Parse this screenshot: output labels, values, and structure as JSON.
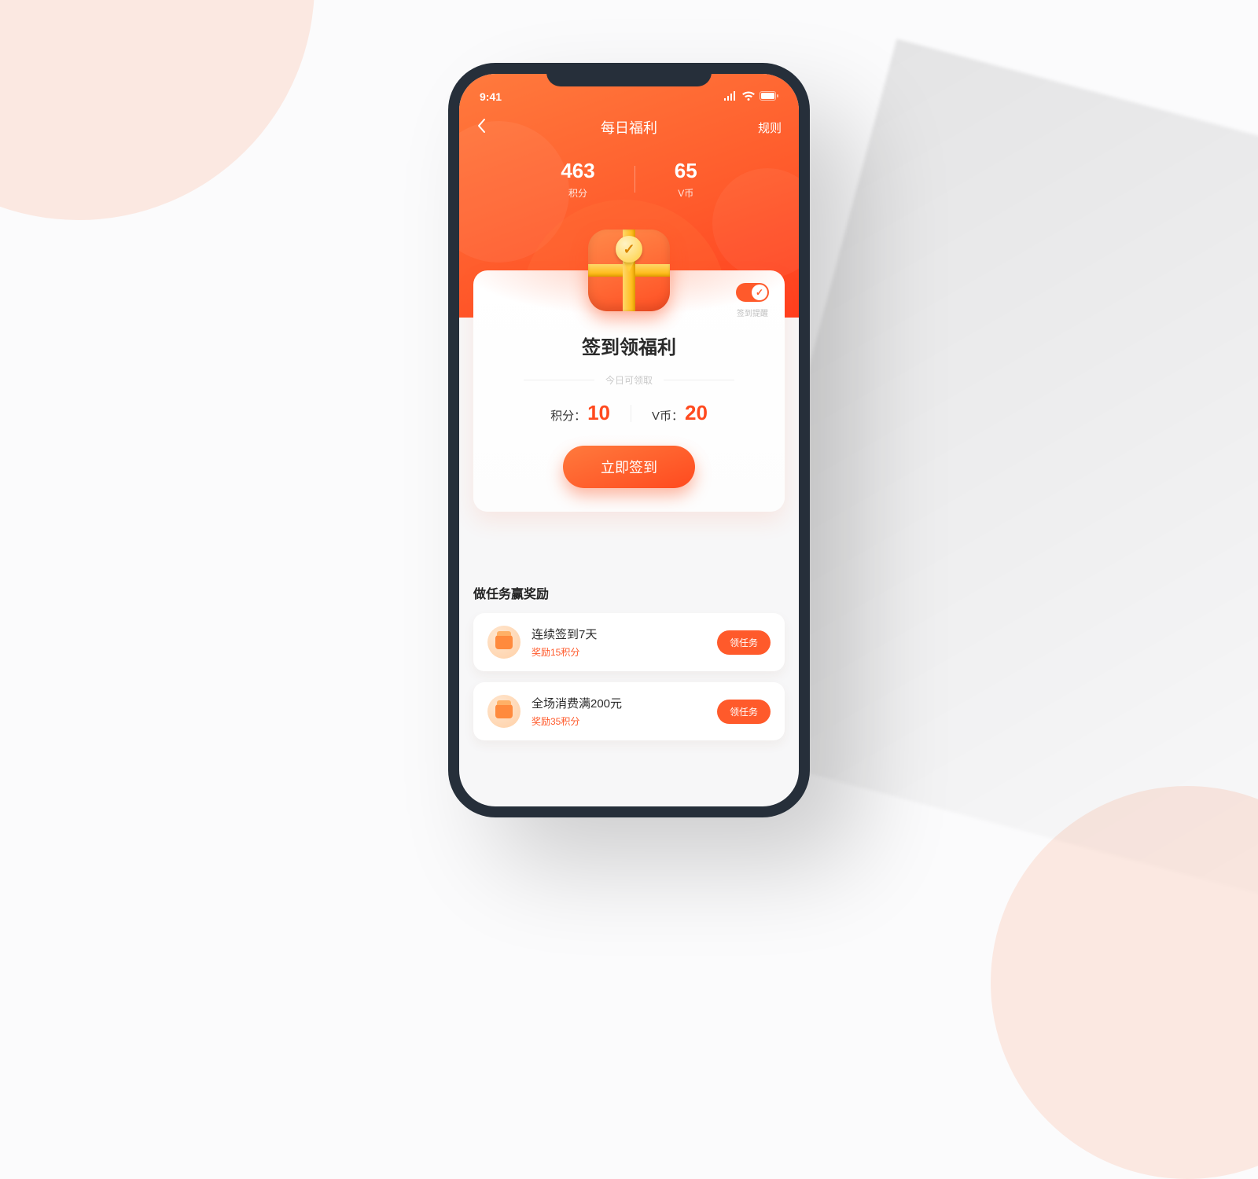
{
  "status_bar": {
    "time": "9:41"
  },
  "nav": {
    "title": "每日福利",
    "rules": "规则"
  },
  "stats": {
    "points_value": "463",
    "points_label": "积分",
    "vcoin_value": "65",
    "vcoin_label": "V币"
  },
  "signin": {
    "reminder_label": "签到提醒",
    "title": "签到领福利",
    "today_label": "今日可领取",
    "points_label": "积分：",
    "points_value": "10",
    "vcoin_label": "V币：",
    "vcoin_value": "20",
    "button": "立即签到"
  },
  "tasks": {
    "section_title": "做任务赢奖励",
    "items": [
      {
        "name": "连续签到7天",
        "reward": "奖励15积分",
        "button": "领任务"
      },
      {
        "name": "全场消费满200元",
        "reward": "奖励35积分",
        "button": "领任务"
      }
    ]
  }
}
